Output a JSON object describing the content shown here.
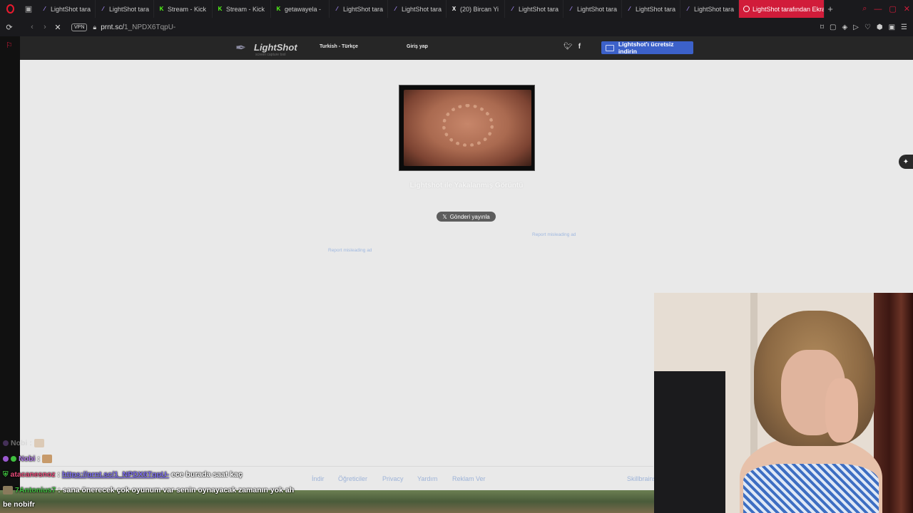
{
  "browser": {
    "tabs": [
      {
        "label": "LightShot tara",
        "icon": "feather-icon",
        "color": "#a78bfa"
      },
      {
        "label": "LightShot tara",
        "icon": "feather-icon",
        "color": "#a78bfa"
      },
      {
        "label": "Stream - Kick",
        "icon": "kick-icon",
        "color": "#53fc18"
      },
      {
        "label": "Stream - Kick",
        "icon": "kick-icon",
        "color": "#53fc18"
      },
      {
        "label": "getawayela -",
        "icon": "kick-icon",
        "color": "#53fc18"
      },
      {
        "label": "LightShot tara",
        "icon": "feather-icon",
        "color": "#a78bfa"
      },
      {
        "label": "LightShot tara",
        "icon": "feather-icon",
        "color": "#a78bfa"
      },
      {
        "label": "(20) Bircan Yi",
        "icon": "x-icon",
        "color": "#ffffff"
      },
      {
        "label": "LightShot tara",
        "icon": "feather-icon",
        "color": "#a78bfa"
      },
      {
        "label": "LightShot tara",
        "icon": "feather-icon",
        "color": "#a78bfa"
      },
      {
        "label": "LightShot tara",
        "icon": "feather-icon",
        "color": "#a78bfa"
      },
      {
        "label": "LightShot tara",
        "icon": "feather-icon",
        "color": "#a78bfa"
      }
    ],
    "active_tab": {
      "label": "LightShot tarafından Ekra"
    },
    "vpn_label": "VPN",
    "url_host": "prnt.sc/",
    "url_path": "1_NPDX6TqpU-"
  },
  "lightshot": {
    "logo_name": "LightShot",
    "logo_tagline": "screen capture tool",
    "language": "Turkish - Türkçe",
    "login": "Giriş yap",
    "download_button": "Lightshot'ı ücretsiz indirin",
    "caption": "Lightshot ile Yakalanmış Görüntü",
    "post_button": "Gönderi yayınla",
    "report_ad_1": "Report misleading ad",
    "report_ad_2": "Report misleading ad",
    "footer": {
      "download": "İndir",
      "tutorials": "Öğreticiler",
      "privacy": "Privacy",
      "help": "Yardım",
      "advertise": "Reklam Ver",
      "skillbrains": "Skillbrains"
    }
  },
  "chat": {
    "messages": [
      {
        "user": "Nobi",
        "text": "",
        "faint": true
      },
      {
        "user": "Nobi",
        "text": ""
      },
      {
        "user": "atacanesnoz",
        "link": "https://prnt.sc/1_NPDX6TqpU-",
        "text": "ece burada saat kaç"
      },
      {
        "user": "7Antonius7",
        "text": "sana önerecek çok oyunum var senin oynayacak zamanın yok ah"
      },
      {
        "user": "",
        "text": "be nobifr"
      }
    ]
  }
}
